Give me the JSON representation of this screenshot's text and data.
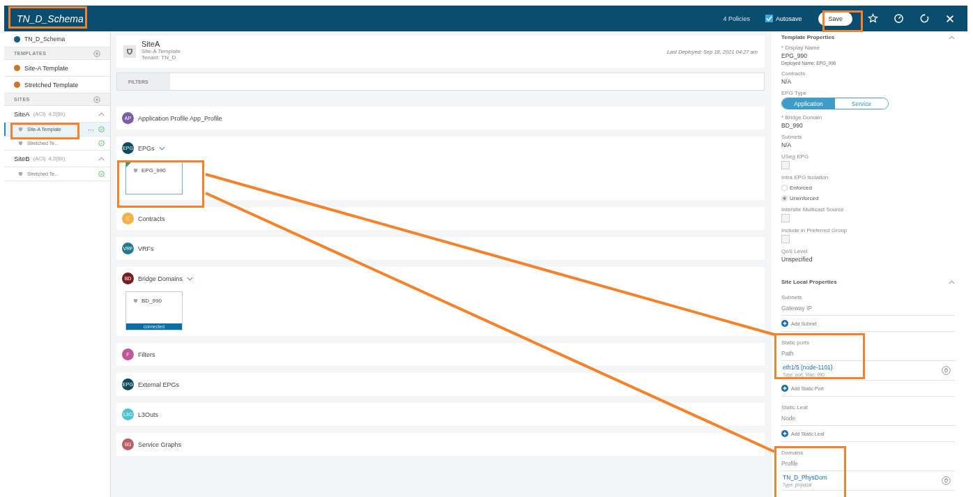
{
  "header": {
    "title": "TN_D_Schema",
    "policies": "4 Policies",
    "autosave": {
      "label": "Autosave",
      "checked": true
    },
    "save": "Save"
  },
  "sidebar": {
    "schema": "TN_D_Schema",
    "templates_heading": "TEMPLATES",
    "templates": [
      {
        "label": "Site-A Template"
      },
      {
        "label": "Stretched Template"
      }
    ],
    "sites_heading": "SITES",
    "sites": [
      {
        "name": "SiteA",
        "meta": "(ACI)  4.2(6h)",
        "expanded": true,
        "templates": [
          {
            "label": "Site-A Template",
            "selected": true,
            "more": "···"
          },
          {
            "label": "Stretched Te...",
            "selected": false
          }
        ]
      },
      {
        "name": "SiteB",
        "meta": "(ACI)  4.2(6h)",
        "expanded": true,
        "templates": [
          {
            "label": "Stretched Te...",
            "selected": false
          }
        ]
      }
    ]
  },
  "main": {
    "site": "SiteA",
    "template": "Site-A Template",
    "tenant": "Tenant: TN_D",
    "last_deployed": "Last Deployed: Sep 18, 2021 04:27 am",
    "filters": "FILTERS",
    "sections": [
      {
        "badge": "AP",
        "label": "Application Profile App_Profile",
        "color": "#7b5ea7"
      },
      {
        "badge": "EPG",
        "label": "EPGs",
        "color": "#0d4a5e",
        "expanded": true,
        "cards": [
          {
            "name": "EPG_990",
            "selected": true
          }
        ]
      },
      {
        "badge": "C",
        "label": "Contracts",
        "color": "#f5b04a"
      },
      {
        "badge": "VRF",
        "label": "VRFs",
        "color": "#1f7a8c"
      },
      {
        "badge": "BD",
        "label": "Bridge Domains",
        "color": "#7a1c1c",
        "expanded": true,
        "cards": [
          {
            "name": "BD_990",
            "selected": false,
            "status": "connected"
          }
        ]
      },
      {
        "badge": "F",
        "label": "Filters",
        "color": "#c2569a"
      },
      {
        "badge": "EPG",
        "label": "External EPGs",
        "color": "#0d4a5e"
      },
      {
        "badge": "L3O",
        "label": "L3Outs",
        "color": "#4cc3cf"
      },
      {
        "badge": "SG",
        "label": "Service Graphs",
        "color": "#b85d6a"
      }
    ]
  },
  "properties": {
    "title": "Template Properties",
    "expanded": true,
    "fields": [
      {
        "kind": "text",
        "label": "* Display Name",
        "value": "EPG_990",
        "note": "Deployed Name: EPG_990"
      },
      {
        "kind": "text",
        "label": "Contracts",
        "value": "N/A"
      },
      {
        "kind": "toggle",
        "label": "EPG Type",
        "options": [
          {
            "label": "Application",
            "selected": true
          },
          {
            "label": "Service",
            "selected": false
          }
        ]
      },
      {
        "kind": "text",
        "label": "* Bridge Domain",
        "value": "BD_990"
      },
      {
        "kind": "text",
        "label": "Subnets",
        "value": "N/A"
      },
      {
        "kind": "checkbox",
        "label": "USeg EPG",
        "checked": false
      },
      {
        "kind": "radio",
        "label": "Intra EPG Isolation",
        "options": [
          {
            "label": "Enforced",
            "selected": false
          },
          {
            "label": "Unenforced",
            "selected": true
          }
        ]
      },
      {
        "kind": "checkbox",
        "label": "Intersite Multicast Source",
        "checked": false
      },
      {
        "kind": "checkbox",
        "label": "Include in Preferred Group",
        "checked": false
      },
      {
        "kind": "text",
        "label": "QoS Level",
        "value": "Unspecified"
      }
    ]
  },
  "site_local": {
    "title": "Site Local Properties",
    "expanded": true,
    "groups": [
      {
        "label": "Subnets",
        "column": "Gateway IP",
        "add": "Add Subnet"
      },
      {
        "label": "Static ports",
        "column": "Path",
        "items": [
          {
            "name": "eth1/5 (node-1101)",
            "detail": "Type: port, Vlan: 990"
          }
        ],
        "add": "Add Static Port"
      },
      {
        "label": "Static Leaf",
        "column": "Node",
        "add": "Add Static Leaf"
      },
      {
        "label": "Domains",
        "column": "Profile",
        "items": [
          {
            "name": "TN_D_PhysDom",
            "detail": "Type: physical"
          }
        ]
      }
    ]
  }
}
